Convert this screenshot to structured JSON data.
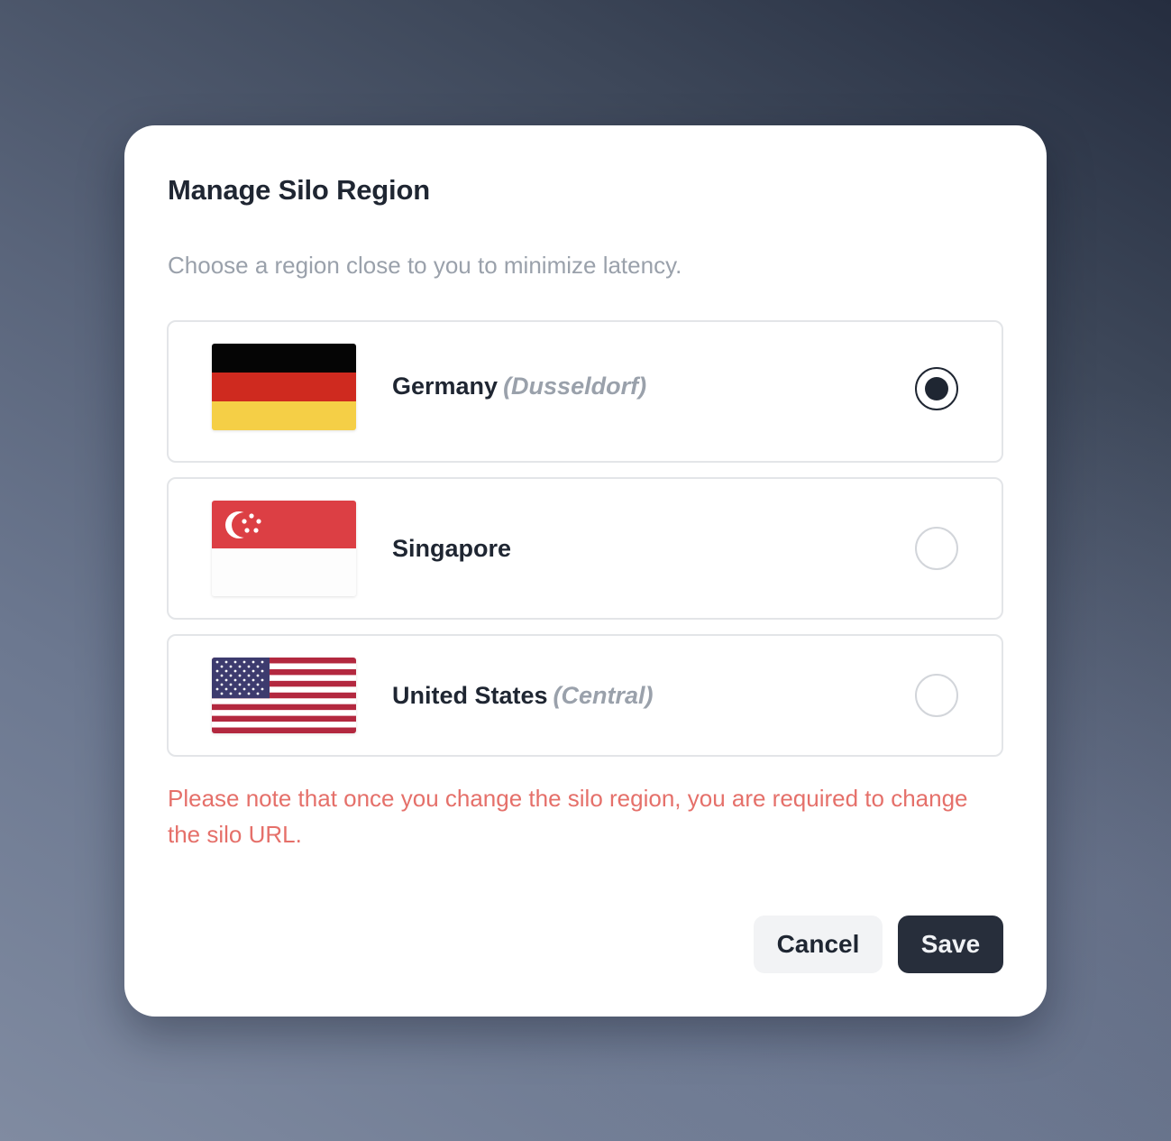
{
  "dialog": {
    "title": "Manage Silo Region",
    "subtitle": "Choose a region close to you to minimize latency.",
    "warning": "Please note that once you change the silo region, you are required to change the silo URL.",
    "cancel_label": "Cancel",
    "save_label": "Save"
  },
  "regions": [
    {
      "name": "Germany",
      "sublabel": "(Dusseldorf)",
      "flag": "germany-flag-icon",
      "selected": true
    },
    {
      "name": "Singapore",
      "sublabel": "",
      "flag": "singapore-flag-icon",
      "selected": false
    },
    {
      "name": "United States",
      "sublabel": "(Central)",
      "flag": "us-flag-icon",
      "selected": false
    }
  ],
  "colors": {
    "primary": "#272e3b",
    "warning": "#e5706a",
    "muted": "#9aa1ab"
  }
}
